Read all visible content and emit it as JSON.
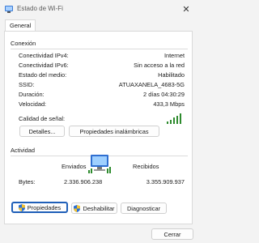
{
  "window": {
    "title": "Estado de Wi-Fi",
    "icon": "wifi-status-icon",
    "close_glyph": "✕"
  },
  "tabs": [
    {
      "label": "General"
    }
  ],
  "connection": {
    "heading": "Conexión",
    "rows": [
      {
        "label": "Conectividad IPv4:",
        "value": "Internet"
      },
      {
        "label": "Conectividad IPv6:",
        "value": "Sin acceso a la red"
      },
      {
        "label": "Estado del medio:",
        "value": "Habilitado"
      },
      {
        "label": "SSID:",
        "value": "ATUAXANELA_4683-5G"
      },
      {
        "label": "Duración:",
        "value": "2 días 04:30:29"
      },
      {
        "label": "Velocidad:",
        "value": "433,3 Mbps"
      }
    ],
    "signal_label": "Calidad de señal:",
    "signal_bars_lit": 5,
    "signal_bars_total": 5,
    "buttons": {
      "details": "Detalles...",
      "wireless_props": "Propiedades inalámbricas"
    }
  },
  "activity": {
    "heading": "Actividad",
    "sent_label": "Enviados",
    "received_label": "Recibidos",
    "bytes_label": "Bytes:",
    "bytes_sent": "2.336.906.238",
    "bytes_received": "3.355.909.937",
    "buttons": {
      "properties": "Propiedades",
      "disable": "Deshabilitar",
      "diagnose": "Diagnosticar"
    }
  },
  "footer": {
    "close": "Cerrar"
  },
  "colors": {
    "accent": "#1f5fb8",
    "signal": "#2e8b2e",
    "shield_blue": "#2a6fd6",
    "shield_yellow": "#f2c230"
  }
}
